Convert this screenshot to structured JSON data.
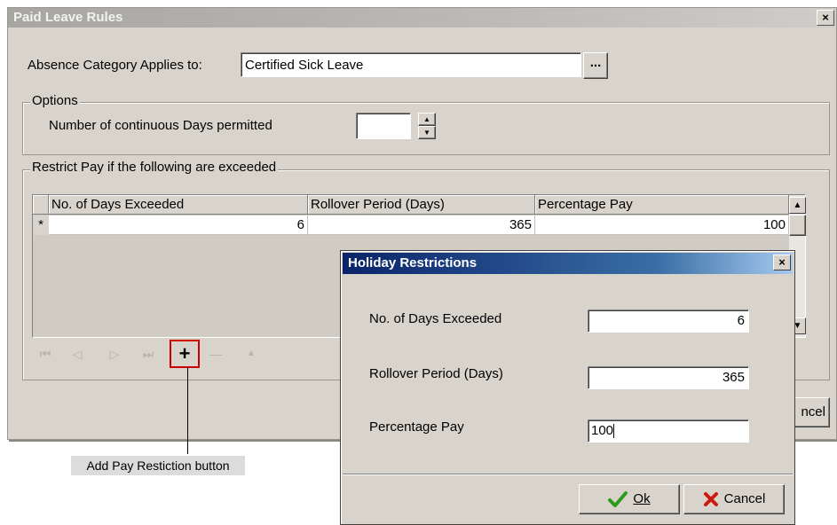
{
  "main_dialog": {
    "title": "Paid Leave Rules",
    "close_glyph": "×",
    "absence_label": "Absence Category Applies to:",
    "absence_value": "Certified Sick Leave",
    "browse_label": "...",
    "options_legend": "Options",
    "continuous_days_label": "Number of continuous Days permitted",
    "continuous_days_value": "",
    "restrict_legend": "Restrict Pay if the following are exceeded",
    "grid": {
      "columns": [
        "No. of Days Exceeded",
        "Rollover Period (Days)",
        "Percentage Pay"
      ],
      "rows": [
        {
          "indicator": "*",
          "days_exceeded": "6",
          "rollover": "365",
          "percentage": "100"
        }
      ]
    },
    "navigator": {
      "first": "⏮",
      "prior": "◁",
      "next": "▷",
      "last": "⏭",
      "add": "+",
      "delete": "—",
      "up": "▲"
    },
    "cancel_partial": "ncel"
  },
  "annotation": {
    "callout_text": "Add Pay Restiction button",
    "highlight_color": "#cc0000"
  },
  "popup": {
    "title": "Holiday Restrictions",
    "close_glyph": "×",
    "fields": [
      {
        "label": "No. of Days Exceeded",
        "value": "6"
      },
      {
        "label": "Rollover Period (Days)",
        "value": "365"
      },
      {
        "label": "Percentage Pay",
        "value": "100"
      }
    ],
    "ok_label": "Ok",
    "cancel_label": "Cancel",
    "ok_icon": "checkmark-icon",
    "cancel_icon": "x-icon"
  },
  "colors": {
    "dialog_bg": "#d8d4cc",
    "popup_title_start": "#0a246a",
    "popup_title_end": "#a6caf0",
    "ok_check": "#2e9a1e",
    "cancel_x": "#cc1a10"
  }
}
